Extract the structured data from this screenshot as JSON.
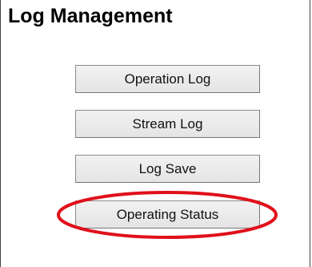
{
  "panel": {
    "title": "Log Management"
  },
  "buttons": [
    {
      "label": "Operation Log"
    },
    {
      "label": "Stream Log"
    },
    {
      "label": "Log Save"
    },
    {
      "label": "Operating Status"
    }
  ],
  "annotation": {
    "color": "#e0101a",
    "target": "Operating Status"
  }
}
